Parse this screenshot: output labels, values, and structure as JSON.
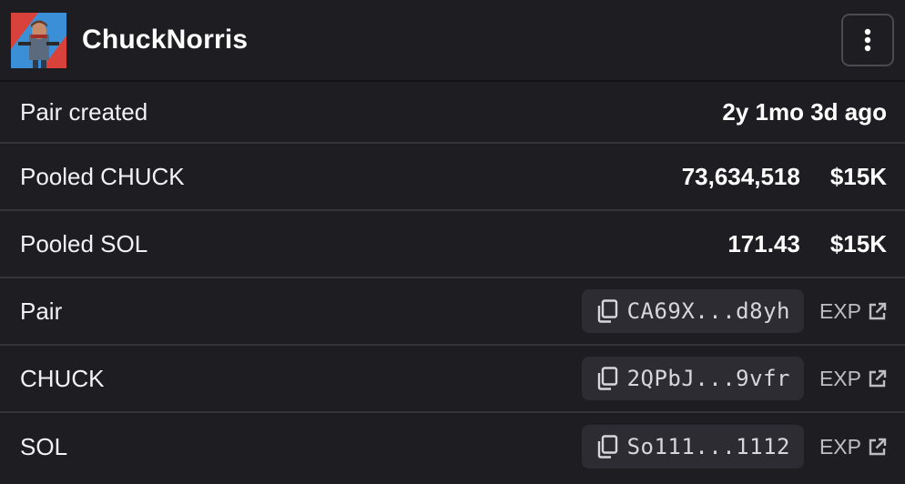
{
  "header": {
    "token_name": "ChuckNorris",
    "avatar_icon": "token-avatar-image",
    "menu_icon": "kebab-menu-icon"
  },
  "rows": {
    "pair_created": {
      "label": "Pair created",
      "value": "2y 1mo 3d ago"
    },
    "pooled_chuck": {
      "label": "Pooled CHUCK",
      "amount": "73,634,518",
      "usd": "$15K"
    },
    "pooled_sol": {
      "label": "Pooled SOL",
      "amount": "171.43",
      "usd": "$15K"
    },
    "pair": {
      "label": "Pair",
      "address": "CA69X...d8yh",
      "explorer": "EXP"
    },
    "chuck": {
      "label": "CHUCK",
      "address": "2QPbJ...9vfr",
      "explorer": "EXP"
    },
    "sol": {
      "label": "SOL",
      "address": "So111...1112",
      "explorer": "EXP"
    }
  },
  "colors": {
    "background": "#1e1e22",
    "divider": "#34343a",
    "chip": "#2c2c32",
    "muted_text": "#bdbdc4"
  }
}
